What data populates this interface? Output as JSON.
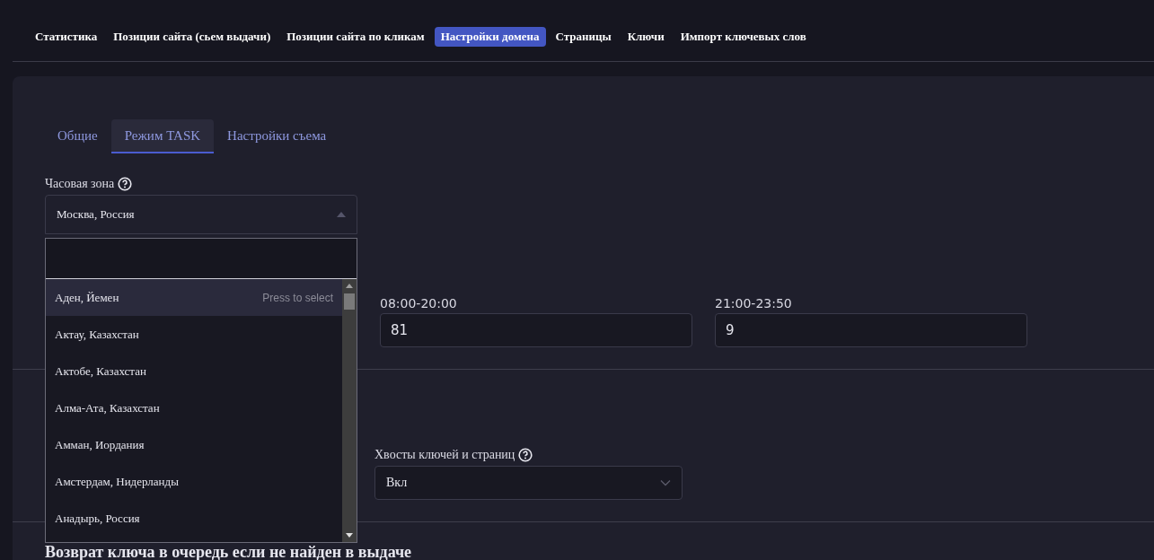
{
  "nav": [
    {
      "label": "Статистика",
      "selected": false
    },
    {
      "label": "Позиции сайта (сьем выдачи)",
      "selected": false
    },
    {
      "label": "Позиции сайта по кликам",
      "selected": false
    },
    {
      "label": "Настройки домена",
      "selected": true
    },
    {
      "label": "Страницы",
      "selected": false
    },
    {
      "label": "Ключи",
      "selected": false
    },
    {
      "label": "Импорт ключевых слов",
      "selected": false
    }
  ],
  "tabs": [
    {
      "label": "Общие",
      "selected": false
    },
    {
      "label": "Режим TASK",
      "selected": true
    },
    {
      "label": "Настройки съема",
      "selected": false
    }
  ],
  "timezone": {
    "label": "Часовая зона",
    "value": "Москва, Россия",
    "expanded": true,
    "options": [
      {
        "label": "Аден, Йемен",
        "selected": true,
        "hint": "Press to select"
      },
      {
        "label": "Актау, Казахстан",
        "selected": false
      },
      {
        "label": "Актобе, Казахстан",
        "selected": false
      },
      {
        "label": "Алма-Ата, Казахстан",
        "selected": false
      },
      {
        "label": "Амман, Иордания",
        "selected": false
      },
      {
        "label": "Амстердам, Нидерланды",
        "selected": false
      },
      {
        "label": "Анадырь, Россия",
        "selected": false
      }
    ]
  },
  "time_fields": [
    {
      "label": "08:00-20:00",
      "value": "81"
    },
    {
      "label": "21:00-23:50",
      "value": "9"
    }
  ],
  "tails": {
    "label": "Хвосты ключей и страниц",
    "value": "Вкл"
  },
  "section_heading": "Возврат ключа в очередь если не найден в выдаче"
}
